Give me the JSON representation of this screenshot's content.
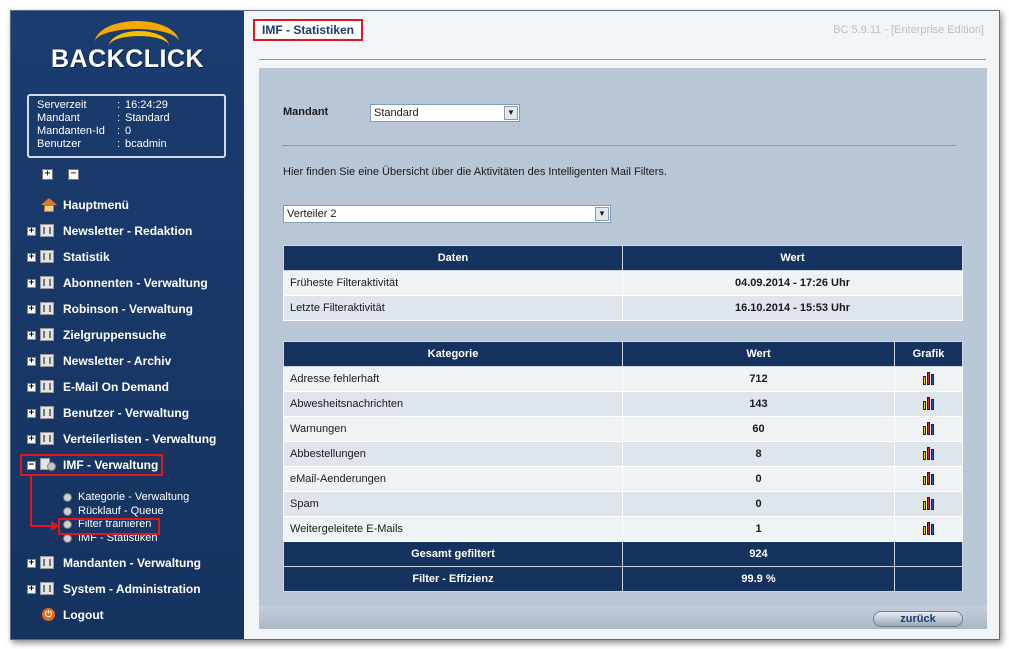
{
  "app": {
    "logo_text": "BACKCLICK",
    "version": "BC 5.9.11 - [Enterprise Edition]"
  },
  "serverinfo": [
    {
      "key": "Serverzeit",
      "value": "16:24:29"
    },
    {
      "key": "Mandant",
      "value": "Standard"
    },
    {
      "key": "Mandanten-Id",
      "value": "0"
    },
    {
      "key": "Benutzer",
      "value": "bcadmin"
    }
  ],
  "tree_controls": {
    "expand": "+",
    "collapse": "−"
  },
  "nav": {
    "home": "Hauptmenü",
    "items": [
      "Newsletter - Redaktion",
      "Statistik",
      "Abonnenten - Verwaltung",
      "Robinson - Verwaltung",
      "Zielgruppensuche",
      "Newsletter - Archiv",
      "E-Mail On Demand",
      "Benutzer - Verwaltung",
      "Verteilerlisten - Verwaltung"
    ],
    "imf": {
      "label": "IMF - Verwaltung",
      "children": [
        "Kategorie - Verwaltung",
        "Rücklauf - Queue",
        "Filter trainieren",
        "IMF - Statistiken"
      ]
    },
    "after": [
      "Mandanten - Verwaltung",
      "System - Administration"
    ],
    "logout": "Logout"
  },
  "page": {
    "title": "IMF - Statistiken",
    "mandant_label": "Mandant",
    "mandant_value": "Standard",
    "intro": "Hier finden Sie eine Übersicht über die Aktivitäten des Intelligenten Mail Filters.",
    "verteiler_value": "Verteiler 2",
    "dates_table": {
      "headers": [
        "Daten",
        "Wert"
      ],
      "rows": [
        {
          "label": "Früheste Filteraktivität",
          "value": "04.09.2014 - 17:26 Uhr"
        },
        {
          "label": "Letzte Filteraktivität",
          "value": "16.10.2014 - 15:53 Uhr"
        }
      ]
    },
    "cat_table": {
      "headers": [
        "Kategorie",
        "Wert",
        "Grafik"
      ],
      "rows": [
        {
          "label": "Adresse fehlerhaft",
          "value": "712"
        },
        {
          "label": "Abwesheitsnachrichten",
          "value": "143"
        },
        {
          "label": "Warnungen",
          "value": "60"
        },
        {
          "label": "Abbestellungen",
          "value": "8"
        },
        {
          "label": "eMail-Aenderungen",
          "value": "0"
        },
        {
          "label": "Spam",
          "value": "0"
        },
        {
          "label": "Weitergeleitete E-Mails",
          "value": "1"
        }
      ],
      "totals": [
        {
          "label": "Gesamt gefiltert",
          "value": "924"
        },
        {
          "label": "Filter - Effizienz",
          "value": "99.9 %"
        }
      ]
    },
    "back_button": "zurück"
  },
  "colors": {
    "nav_bg": "#1b3c70",
    "accent": "#f5a800",
    "highlight": "#e4161d",
    "header_bg": "#16335f"
  }
}
